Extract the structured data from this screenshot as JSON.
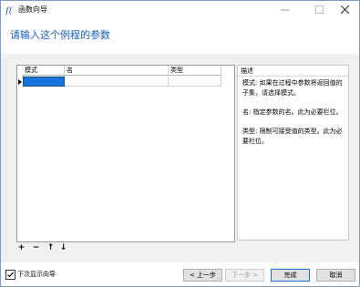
{
  "window": {
    "title": "函数向导"
  },
  "heading": "请输入这个例程的参数",
  "grid": {
    "columns": [
      "模式",
      "名",
      "类型"
    ],
    "rows": [
      {
        "mode": "",
        "name": "",
        "type": ""
      }
    ]
  },
  "description": {
    "title": "描述",
    "paragraphs": [
      "模式: 如果在过程中参数将返回值的子集，请选择模式。",
      "名: 指定参数的名。此为必要栏位。",
      "类型: 限制可接受值的类型。此为必要栏位。"
    ]
  },
  "toolbar": {
    "add": "+",
    "remove": "−",
    "up": "↑",
    "down": "↓"
  },
  "footer": {
    "checkbox_label": "下次显示向导",
    "checkbox_checked": true,
    "prev": "< 上一步",
    "next": "下一步 >",
    "finish": "完成",
    "cancel": "取消"
  },
  "colors": {
    "accent": "#1a5fb4",
    "selection": "#1a73d9"
  }
}
